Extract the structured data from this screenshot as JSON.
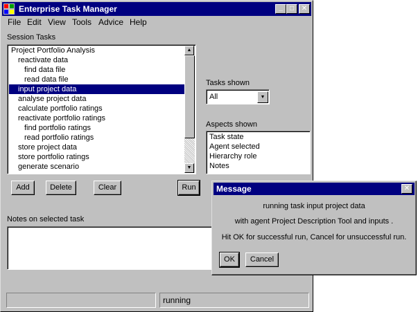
{
  "window": {
    "title": "Enterprise Task Manager",
    "minimize": "_",
    "maximize": "□",
    "close": "✕"
  },
  "menu": [
    "File",
    "Edit",
    "View",
    "Tools",
    "Advice",
    "Help"
  ],
  "session_tasks": {
    "label": "Session Tasks",
    "items": [
      "Project Portfolio Analysis",
      "reactivate data",
      "find data file",
      "read data file",
      "input project data",
      "analyse project data",
      "calculate portfolio ratings",
      "reactivate portfolio ratings",
      "find portfolio ratings",
      "read portfolio ratings",
      "store project data",
      "store portfolio ratings",
      "generate scenario"
    ],
    "selected": "input project data"
  },
  "buttons": {
    "add": "Add",
    "delete": "Delete",
    "clear": "Clear",
    "run": "Run"
  },
  "tasks_shown": {
    "label": "Tasks shown",
    "value": "All"
  },
  "aspects_shown": {
    "label": "Aspects shown",
    "items": [
      "Task state",
      "Agent selected",
      "Hierarchy role",
      "Notes"
    ]
  },
  "notes": {
    "label": "Notes on selected task",
    "value": ""
  },
  "status": {
    "left": "",
    "right": "running"
  },
  "message": {
    "title": "Message",
    "close": "✕",
    "line1": "running task input project data",
    "line2": "with agent Project Description Tool and inputs .",
    "line3": "Hit OK for successful run, Cancel for unsuccessful run.",
    "ok": "OK",
    "cancel": "Cancel"
  },
  "colors": {
    "titlebar": "#000080",
    "face": "#c0c0c0",
    "selection": "#000080"
  }
}
